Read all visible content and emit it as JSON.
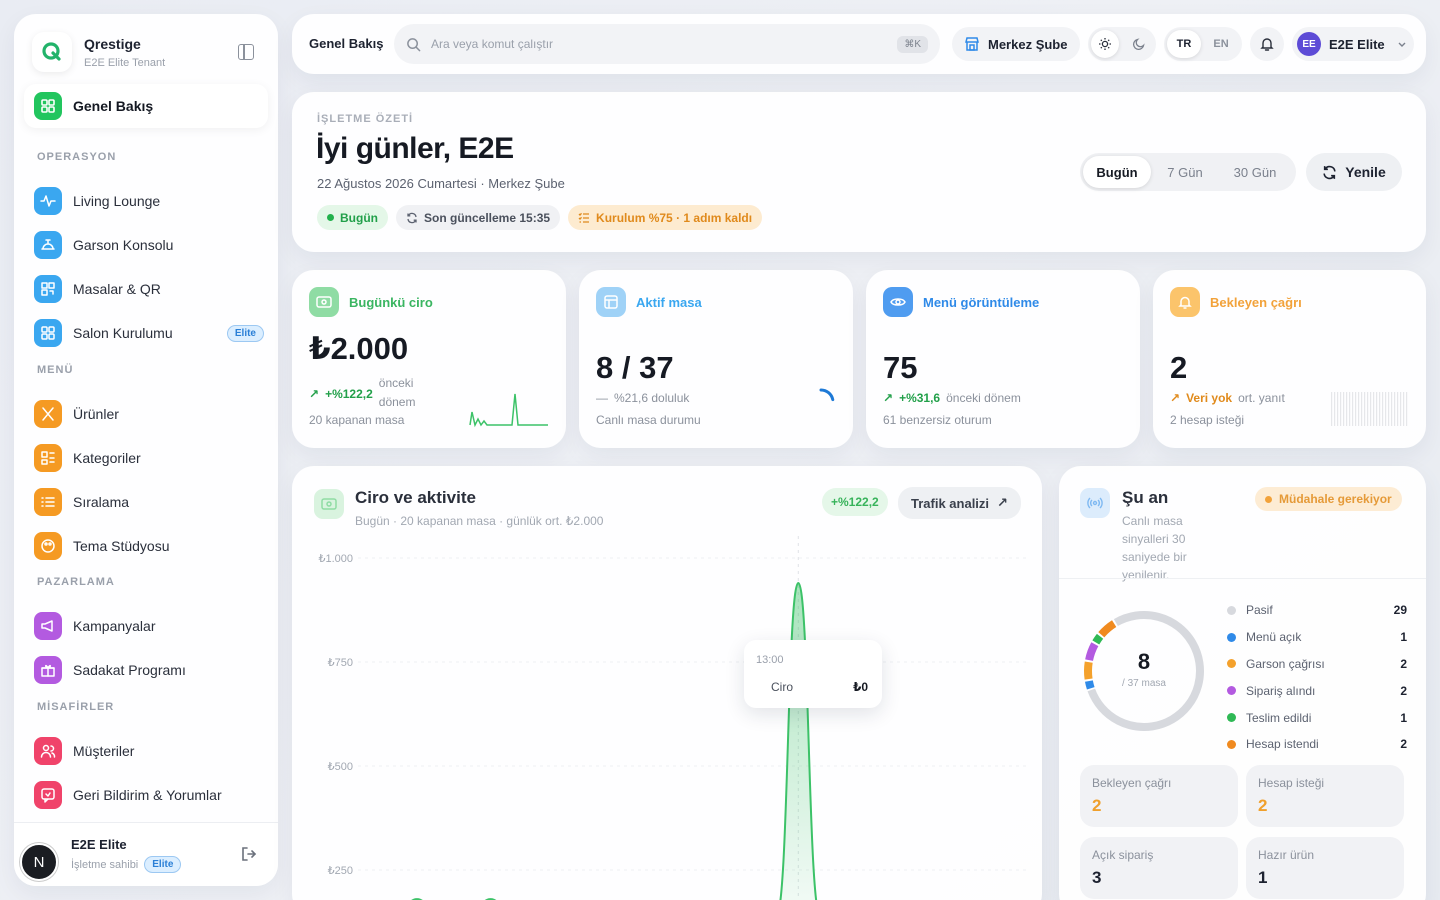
{
  "brand": {
    "name": "Qrestige",
    "tenant": "E2E Elite Tenant"
  },
  "sidebar": {
    "active": {
      "label": "Genel Bakış",
      "icon": "grid-icon"
    },
    "sections": [
      {
        "title": "OPERASYON",
        "items": [
          {
            "label": "Living Lounge",
            "icon": "activity-icon",
            "color": "#3aa7f0"
          },
          {
            "label": "Garson Konsolu",
            "icon": "bell-service-icon",
            "color": "#3aa7f0"
          },
          {
            "label": "Masalar & QR",
            "icon": "qr-icon",
            "color": "#3aa7f0"
          },
          {
            "label": "Salon Kurulumu",
            "icon": "grid-icon",
            "color": "#3aa7f0",
            "badge": "Elite"
          }
        ]
      },
      {
        "title": "MENÜ",
        "items": [
          {
            "label": "Ürünler",
            "icon": "utensils-icon",
            "color": "#f59a23"
          },
          {
            "label": "Kategoriler",
            "icon": "category-icon",
            "color": "#f59a23"
          },
          {
            "label": "Sıralama",
            "icon": "list-order-icon",
            "color": "#f59a23"
          },
          {
            "label": "Tema Stüdyosu",
            "icon": "palette-icon",
            "color": "#f59a23"
          }
        ]
      },
      {
        "title": "PAZARLAMA",
        "items": [
          {
            "label": "Kampanyalar",
            "icon": "megaphone-icon",
            "color": "#b35ae0"
          },
          {
            "label": "Sadakat Programı",
            "icon": "gift-icon",
            "color": "#b35ae0"
          }
        ]
      },
      {
        "title": "MİSAFİRLER",
        "items": [
          {
            "label": "Müşteriler",
            "icon": "users-icon",
            "color": "#f0436a"
          },
          {
            "label": "Geri Bildirim & Yorumlar",
            "icon": "feedback-icon",
            "color": "#f0436a"
          }
        ]
      }
    ],
    "user": {
      "initial": "N",
      "name": "E2E Elite",
      "role": "İşletme sahibi",
      "badge": "Elite"
    }
  },
  "topbar": {
    "title": "Genel Bakış",
    "search_placeholder": "Ara veya komut çalıştır",
    "shortcut": "⌘K",
    "branch": "Merkez Şube",
    "lang_active": "TR",
    "lang_other": "EN",
    "account_initials": "EE",
    "account_name": "E2E Elite"
  },
  "hero": {
    "eyebrow": "İŞLETME ÖZETİ",
    "greeting": "İyi günler, E2E",
    "date": "22 Ağustos 2026 Cumartesi · Merkez Şube",
    "chip_today": "Bugün",
    "chip_update": "Son güncelleme 15:35",
    "chip_setup": "Kurulum %75 · 1 adım kaldı",
    "ranges": [
      "Bugün",
      "7 Gün",
      "30 Gün"
    ],
    "refresh": "Yenile"
  },
  "stats": {
    "revenue": {
      "label": "Bugünkü ciro",
      "value": "₺2.000",
      "delta": "+%122,2",
      "delta_note": "önceki dönem",
      "foot": "20 kapanan masa"
    },
    "tables": {
      "label": "Aktif masa",
      "value": "8 / 37",
      "delta": "%21,6 doluluk",
      "foot": "Canlı masa durumu",
      "occupancy": 0.216
    },
    "views": {
      "label": "Menü görüntüleme",
      "value": "75",
      "delta": "+%31,6",
      "delta_note": "önceki dönem",
      "foot": "61 benzersiz oturum"
    },
    "calls": {
      "label": "Bekleyen çağrı",
      "value": "2",
      "delta": "Veri yok",
      "delta_note": "ort. yanıt",
      "foot": "2 hesap isteği"
    }
  },
  "chart_card": {
    "title": "Ciro ve aktivite",
    "subtitle": "Bugün · 20 kapanan masa · günlük ort. ₺2.000",
    "delta_pill": "+%122,2",
    "traffic_button": "Trafik analizi",
    "tooltip": {
      "time": "13:00",
      "label": "Ciro",
      "value": "₺0"
    }
  },
  "chart_data": {
    "type": "area",
    "title": "",
    "y_ticks": [
      "₺1.000",
      "₺750",
      "₺500",
      "₺250"
    ],
    "ylim": [
      0,
      1000
    ],
    "grid": true,
    "series": [
      {
        "name": "Ciro",
        "color": "#3cc268",
        "peaks": [
          {
            "x": 0.13,
            "y": 180
          },
          {
            "x": 0.24,
            "y": 180
          },
          {
            "x": 0.7,
            "y": 940
          }
        ]
      }
    ]
  },
  "now_card": {
    "title": "Şu an",
    "subtitle": "Canlı masa sinyalleri 30 saniyede bir yenilenir.",
    "alert": "Müdahale gerekiyor",
    "donut_value": "8",
    "donut_sub": "/ 37 masa",
    "legend": [
      {
        "label": "Pasif",
        "count": "29",
        "color": "#d7d9de"
      },
      {
        "label": "Menü açık",
        "count": "1",
        "color": "#2f8ae8"
      },
      {
        "label": "Garson çağrısı",
        "count": "2",
        "color": "#f4a12c"
      },
      {
        "label": "Sipariş alındı",
        "count": "2",
        "color": "#b35ae0"
      },
      {
        "label": "Teslim edildi",
        "count": "1",
        "color": "#2fb955"
      },
      {
        "label": "Hesap istendi",
        "count": "2",
        "color": "#f08a1f"
      }
    ],
    "tiles": [
      {
        "label": "Bekleyen çağrı",
        "value": "2",
        "color": "#f0a02c"
      },
      {
        "label": "Hesap isteği",
        "value": "2",
        "color": "#f0a02c"
      },
      {
        "label": "Açık sipariş",
        "value": "3",
        "color": "#1d2230"
      },
      {
        "label": "Hazır ürün",
        "value": "1",
        "color": "#1d2230"
      }
    ]
  }
}
